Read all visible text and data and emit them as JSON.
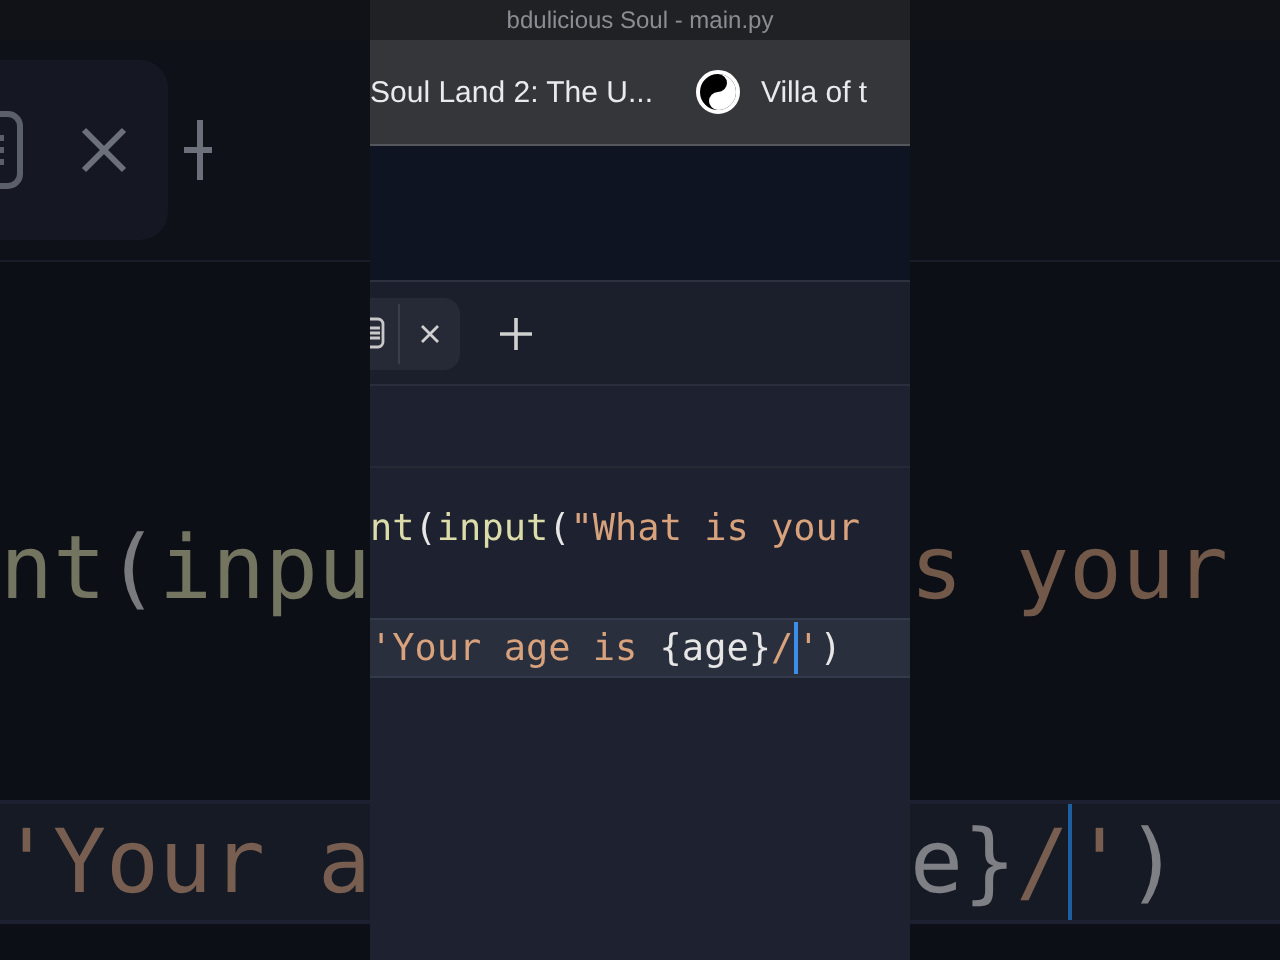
{
  "title_bar": {
    "title": "bdulicious Soul - main.py"
  },
  "bookmarks": [
    {
      "label": "Soul Land 2: The U...",
      "has_icon": false
    },
    {
      "label": "Villa of t",
      "has_icon": true
    }
  ],
  "editor": {
    "lines": [
      {
        "current": false,
        "tokens": [
          {
            "kind": "func",
            "text": "nt"
          },
          {
            "kind": "punct",
            "text": "("
          },
          {
            "kind": "func",
            "text": "input"
          },
          {
            "kind": "punct",
            "text": "("
          },
          {
            "kind": "string",
            "text": "\"What is your"
          }
        ]
      },
      {
        "current": true,
        "tokens": [
          {
            "kind": "string",
            "text": "'Your age is "
          },
          {
            "kind": "punct",
            "text": "{age}"
          },
          {
            "kind": "string",
            "text": "/"
          },
          {
            "kind": "cursor"
          },
          {
            "kind": "string",
            "text": "'"
          },
          {
            "kind": "punct",
            "text": ")"
          }
        ]
      }
    ]
  },
  "backdrop": {
    "left": [
      {
        "current": false,
        "tokens": [
          {
            "kind": "func",
            "text": "nt"
          },
          {
            "kind": "punct",
            "text": "("
          },
          {
            "kind": "func",
            "text": "inpu"
          }
        ]
      },
      {
        "current": true,
        "tokens": [
          {
            "kind": "string",
            "text": "'Your a"
          }
        ]
      }
    ],
    "right": [
      {
        "current": false,
        "tokens": [
          {
            "kind": "string",
            "text": "s your"
          }
        ]
      },
      {
        "current": true,
        "tokens": [
          {
            "kind": "punct",
            "text": "e}"
          },
          {
            "kind": "string",
            "text": "/"
          },
          {
            "kind": "cursor"
          },
          {
            "kind": "string",
            "text": "'"
          },
          {
            "kind": "punct",
            "text": ")"
          }
        ]
      }
    ]
  }
}
